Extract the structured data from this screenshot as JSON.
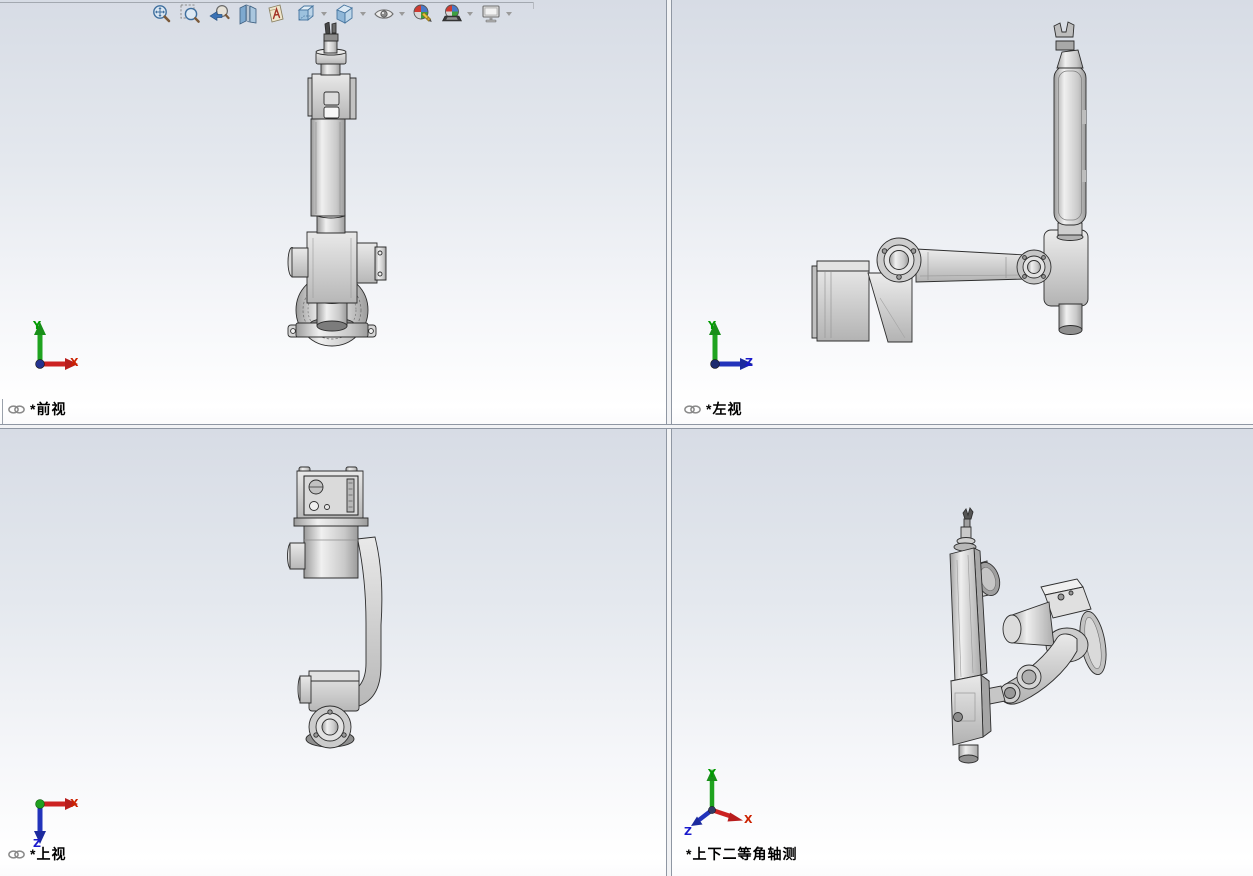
{
  "toolbar": {
    "icons": [
      {
        "name": "zoom-to-fit",
        "dropdown": false
      },
      {
        "name": "zoom-to-area",
        "dropdown": false
      },
      {
        "name": "previous-view",
        "dropdown": false
      },
      {
        "name": "section-view",
        "dropdown": false
      },
      {
        "name": "annotation-visibility",
        "dropdown": false
      },
      {
        "name": "view-orientation",
        "dropdown": true
      },
      {
        "name": "display-style",
        "dropdown": true
      },
      {
        "name": "hide-show-items",
        "dropdown": true
      },
      {
        "name": "edit-appearance",
        "dropdown": false
      },
      {
        "name": "apply-scene",
        "dropdown": true
      },
      {
        "name": "view-settings",
        "dropdown": true
      }
    ]
  },
  "viewports": [
    {
      "name": "front",
      "label": "*前视",
      "linked": true,
      "axis_up": "Y",
      "axis_right": "X"
    },
    {
      "name": "left",
      "label": "*左视",
      "linked": true,
      "axis_up": "Y",
      "axis_right": "Z"
    },
    {
      "name": "top",
      "label": "*上视",
      "linked": true,
      "axis_right": "X",
      "axis_down": "Z"
    },
    {
      "name": "isometric",
      "label": "*上下二等角轴测",
      "linked": false,
      "axis_up": "Y",
      "axis_right": "X",
      "axis_left": "Z"
    }
  ],
  "colors": {
    "axis_x": "#cc2200",
    "axis_y": "#009b00",
    "axis_z": "#1a1acc",
    "viewport_bg_top": "#d7dce5",
    "viewport_bg_bottom": "#ffffff",
    "divider": "#8f97a3"
  }
}
